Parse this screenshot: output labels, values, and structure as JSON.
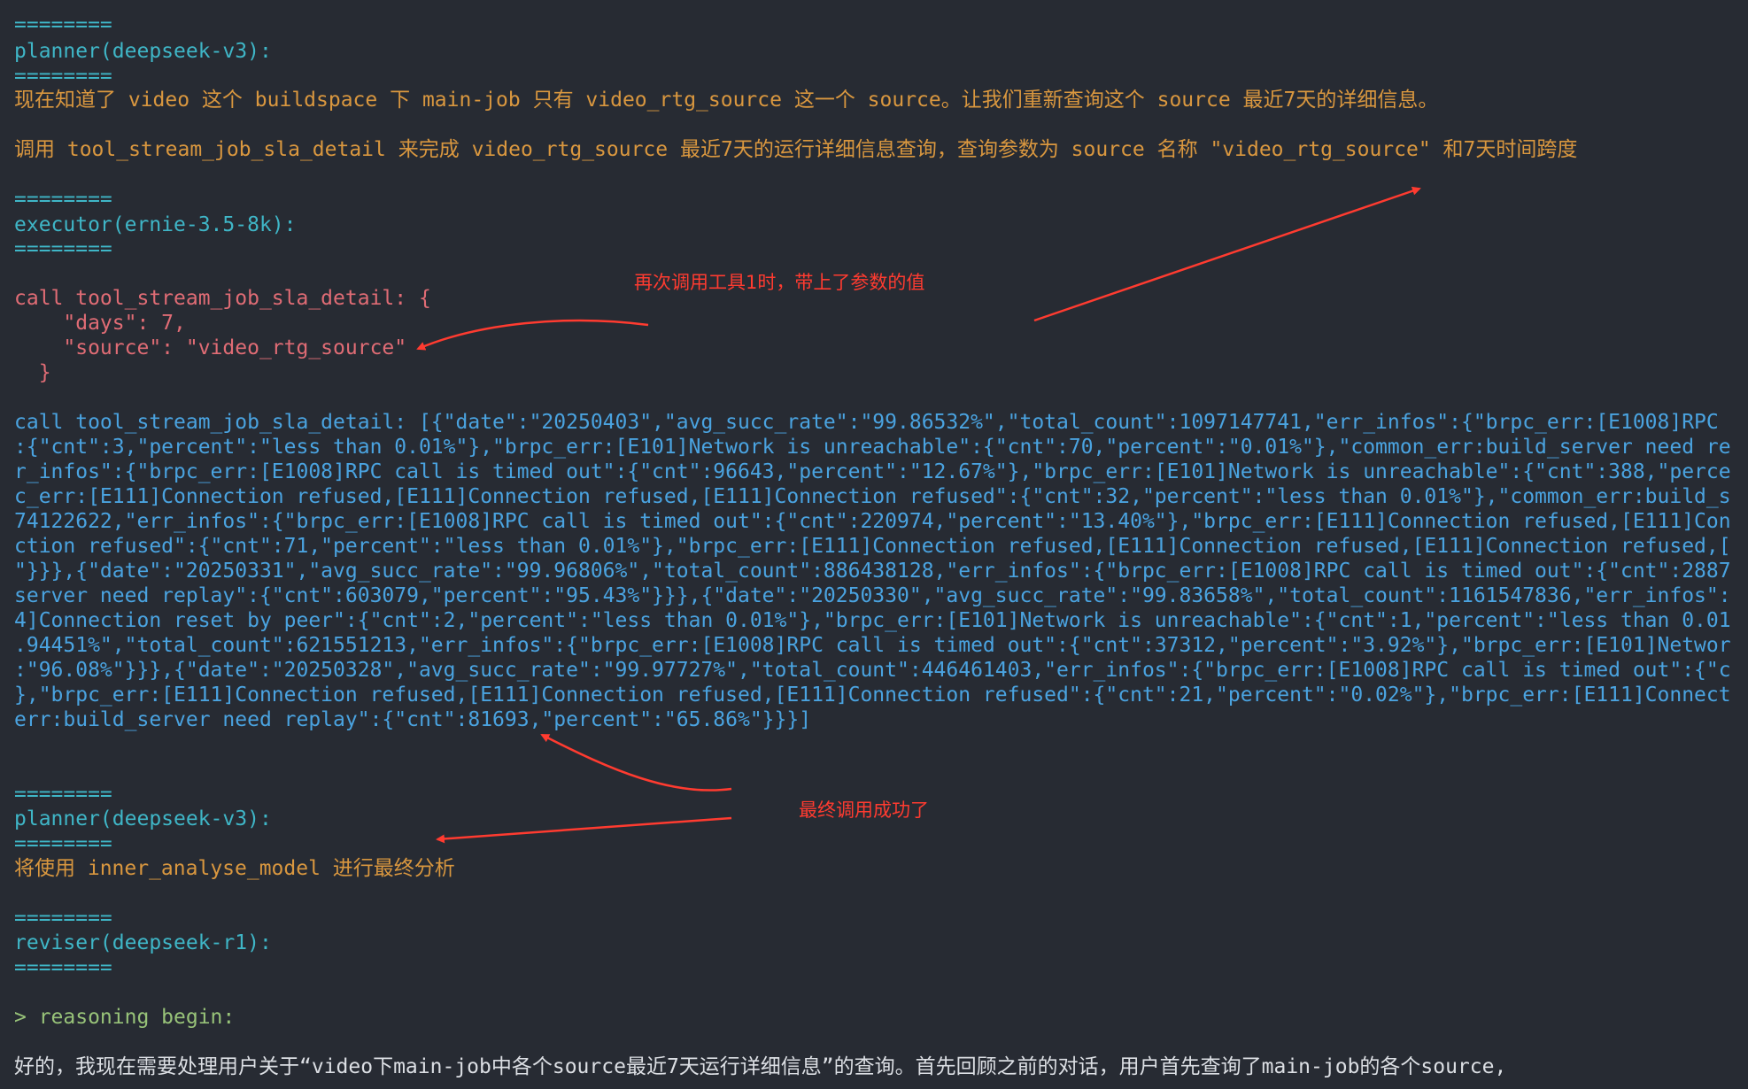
{
  "separator": "========",
  "block1": {
    "agent": "planner(deepseek-v3):",
    "line1": "现在知道了 video 这个 buildspace 下 main-job 只有 video_rtg_source 这一个 source。让我们重新查询这个 source 最近7天的详细信息。",
    "line2": "调用 tool_stream_job_sla_detail 来完成 video_rtg_source 最近7天的运行详细信息查询，查询参数为 source 名称 \"video_rtg_source\" 和7天时间跨度"
  },
  "block2": {
    "agent": "executor(ernie-3.5-8k):",
    "call_lines": [
      "call tool_stream_job_sla_detail: {",
      "    \"days\": 7,",
      "    \"source\": \"video_rtg_source\"",
      "  }"
    ],
    "result_lines": [
      "call tool_stream_job_sla_detail: [{\"date\":\"20250403\",\"avg_succ_rate\":\"99.86532%\",\"total_count\":1097147741,\"err_infos\":{\"brpc_err:[E1008]RPC",
      ":{\"cnt\":3,\"percent\":\"less than 0.01%\"},\"brpc_err:[E101]Network is unreachable\":{\"cnt\":70,\"percent\":\"0.01%\"},\"common_err:build_server need re",
      "r_infos\":{\"brpc_err:[E1008]RPC call is timed out\":{\"cnt\":96643,\"percent\":\"12.67%\"},\"brpc_err:[E101]Network is unreachable\":{\"cnt\":388,\"perce",
      "c_err:[E111]Connection refused,[E111]Connection refused,[E111]Connection refused\":{\"cnt\":32,\"percent\":\"less than 0.01%\"},\"common_err:build_s",
      "74122622,\"err_infos\":{\"brpc_err:[E1008]RPC call is timed out\":{\"cnt\":220974,\"percent\":\"13.40%\"},\"brpc_err:[E111]Connection refused,[E111]Con",
      "ction refused\":{\"cnt\":71,\"percent\":\"less than 0.01%\"},\"brpc_err:[E111]Connection refused,[E111]Connection refused,[E111]Connection refused,[",
      "\"}}},{\"date\":\"20250331\",\"avg_succ_rate\":\"99.96806%\",\"total_count\":886438128,\"err_infos\":{\"brpc_err:[E1008]RPC call is timed out\":{\"cnt\":2887",
      "server need replay\":{\"cnt\":603079,\"percent\":\"95.43%\"}}},{\"date\":\"20250330\",\"avg_succ_rate\":\"99.83658%\",\"total_count\":1161547836,\"err_infos\":",
      "4]Connection reset by peer\":{\"cnt\":2,\"percent\":\"less than 0.01%\"},\"brpc_err:[E101]Network is unreachable\":{\"cnt\":1,\"percent\":\"less than 0.01",
      ".94451%\",\"total_count\":621551213,\"err_infos\":{\"brpc_err:[E1008]RPC call is timed out\":{\"cnt\":37312,\"percent\":\"3.92%\"},\"brpc_err:[E101]Networ",
      ":\"96.08%\"}}},{\"date\":\"20250328\",\"avg_succ_rate\":\"99.97727%\",\"total_count\":446461403,\"err_infos\":{\"brpc_err:[E1008]RPC call is timed out\":{\"c",
      "},\"brpc_err:[E111]Connection refused,[E111]Connection refused,[E111]Connection refused\":{\"cnt\":21,\"percent\":\"0.02%\"},\"brpc_err:[E111]Connect",
      "err:build_server need replay\":{\"cnt\":81693,\"percent\":\"65.86%\"}}}]"
    ]
  },
  "block3": {
    "agent": "planner(deepseek-v3):",
    "line1": "将使用 inner_analyse_model 进行最终分析"
  },
  "block4": {
    "agent": "reviser(deepseek-r1):",
    "reasoning_label": "> reasoning begin:",
    "reasoning_text": "好的，我现在需要处理用户关于“video下main-job中各个source最近7天运行详细信息”的查询。首先回顾之前的对话，用户首先查询了main-job的各个source,"
  },
  "annotations": {
    "note1": "再次调用工具1时，带上了参数的值",
    "note2": "最终调用成功了"
  },
  "colors": {
    "background": "#272b33",
    "separator": "#3fb6c7",
    "planner_text": "#d9973f",
    "call": "#e06c75",
    "result": "#4aa3e0",
    "reasoning": "#98c379",
    "annotation": "#ff3b30"
  }
}
